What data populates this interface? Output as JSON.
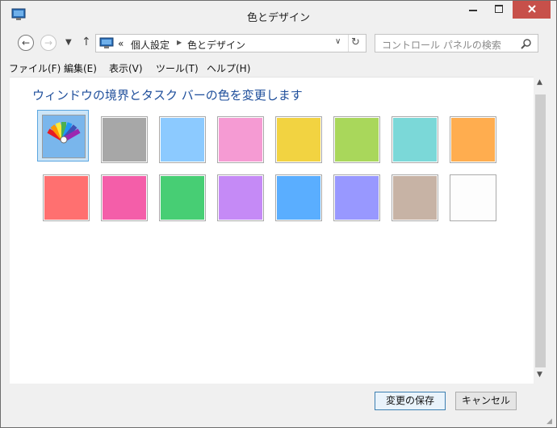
{
  "window": {
    "title": "色とデザイン"
  },
  "address": {
    "prefix": "«",
    "crumbs": [
      "個人設定",
      "色とデザイン"
    ]
  },
  "search": {
    "placeholder": "コントロール パネルの検索"
  },
  "menu": {
    "items": [
      "ファイル(F)",
      "編集(E)",
      "表示(V)",
      "ツール(T)",
      "ヘルプ(H)"
    ]
  },
  "main": {
    "heading": "ウィンドウの境界とタスク バーの色を変更します",
    "swatches_row1": [
      "auto",
      "#a7a7a7",
      "#8ccaff",
      "#f59bd3",
      "#f2d341",
      "#a9d75b",
      "#7bd8d8",
      "#ffad4f"
    ],
    "swatches_row2": [
      "#ff7070",
      "#f45ea9",
      "#47ce74",
      "#c58af6",
      "#5aaeff",
      "#9898ff",
      "#c7b3a5",
      "#fdfdfd"
    ],
    "selected_index": 0
  },
  "buttons": {
    "save": "変更の保存",
    "cancel": "キャンセル"
  }
}
